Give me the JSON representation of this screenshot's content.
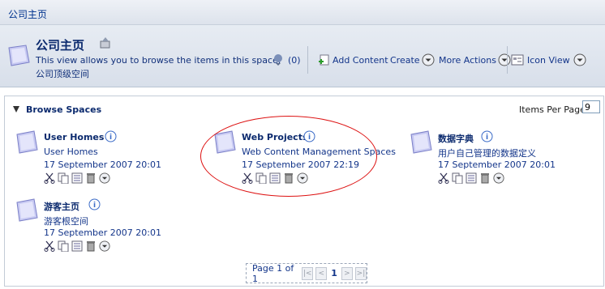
{
  "breadcrumb": "公司主页",
  "header": {
    "title": "公司主页",
    "description": "This view allows you to browse the items in this space.",
    "subtitle": "公司顶级空间",
    "rss_count": "(0)",
    "add_content": "Add Content",
    "create": "Create",
    "more_actions": "More Actions",
    "icon_view": "Icon View"
  },
  "panel": {
    "title": "Browse Spaces",
    "items_per_page_label": "Items Per Page",
    "items_per_page_value": "9"
  },
  "spaces": [
    {
      "name": "User Homes",
      "description": "User Homes",
      "date": "17 September 2007 20:01"
    },
    {
      "name": "Web Projects",
      "description": "Web Content Management Spaces",
      "date": "17 September 2007 22:19"
    },
    {
      "name": "数据字典",
      "description": "用户自己管理的数据定义",
      "date": "17 September 2007 20:01"
    },
    {
      "name": "游客主页",
      "description": "游客根空间",
      "date": "17 September 2007 20:01"
    }
  ],
  "pager": {
    "label": "Page 1 of 1",
    "current": "1"
  },
  "colors": {
    "annotation_circle": "#dd1111",
    "link": "#0b2a6e",
    "header_bg": "#dde3ec"
  }
}
